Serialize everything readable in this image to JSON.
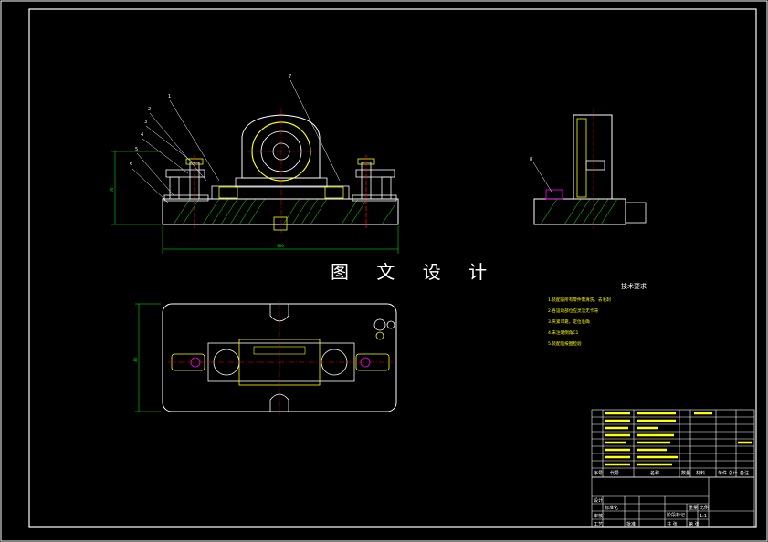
{
  "watermark": "图 文 设 计",
  "technical_requirements": {
    "title": "技术要求",
    "lines": [
      "1.装配前所有零件需清洗、去毛刺",
      "2.各运动部位应灵活无卡滞",
      "3.夹紧可靠，定位准确",
      "4.未注明倒角C1",
      "5.装配后按图检验"
    ]
  },
  "balloons_front": [
    "1",
    "2",
    "3",
    "4",
    "5",
    "6",
    "7"
  ],
  "balloon_side": "8",
  "dimensions": {
    "front_width": "300",
    "front_height": "70",
    "top_height": "80"
  },
  "title_block": {
    "header_cells": [
      "序号",
      "代号",
      "名称",
      "数量",
      "材料",
      "单件 总计",
      "备注"
    ],
    "footer_labels": [
      "设计",
      "标准化",
      "审核",
      "工艺",
      "批准",
      "阶段标记",
      "重量",
      "比例",
      "共 张",
      "第 张"
    ],
    "scale": "1:1"
  },
  "colors": {
    "background": "#000000",
    "frame": "#ffffff",
    "outline": "#ffffff",
    "hatch": "#00ff00",
    "centerline": "#ff0000",
    "fixture_yellow": "#ffff00",
    "dimension": "#00ff00"
  }
}
